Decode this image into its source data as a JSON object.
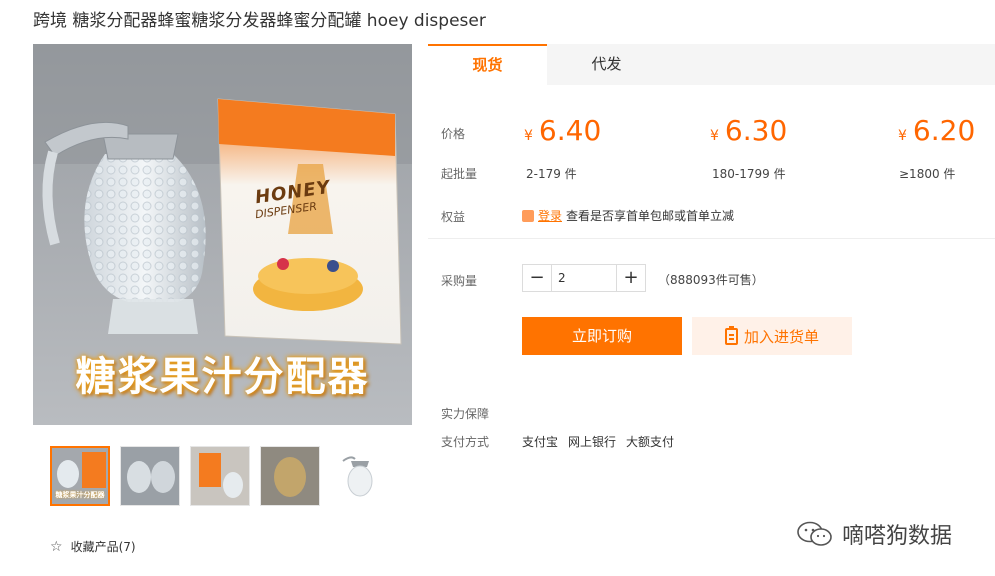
{
  "product": {
    "title": "跨境 糖浆分配器蜂蜜糖浆分发器蜂蜜分配罐 hoey dispeser",
    "image_overlay_text": "糖浆果汁分配器",
    "box_brand": "HONEY",
    "box_sub": "DISPENSER",
    "thumb_caption": "糖浆果汁分配器",
    "favorite": "收藏产品(7)"
  },
  "tabs": [
    {
      "label": "现货",
      "active": true
    },
    {
      "label": "代发",
      "active": false
    }
  ],
  "pricing": {
    "price_label": "价格",
    "currency": "¥",
    "tiers": [
      {
        "price": "6.40",
        "range": "2-179 件"
      },
      {
        "price": "6.30",
        "range": "180-1799 件"
      },
      {
        "price": "6.20",
        "range": "≥1800 件"
      }
    ],
    "min_qty_label": "起批量"
  },
  "benefit": {
    "label": "权益",
    "login": "登录",
    "text": "查看是否享首单包邮或首单立减"
  },
  "purchase": {
    "label": "采购量",
    "quantity": "2",
    "stock": "（888093件可售）",
    "buy_now": "立即订购",
    "add_to_list": "加入进货单"
  },
  "guarantee_label": "实力保障",
  "payment": {
    "label": "支付方式",
    "methods": [
      "支付宝",
      "网上银行",
      "大额支付"
    ]
  },
  "watermark": "嘀嗒狗数据",
  "colors": {
    "accent": "#ff7300",
    "price": "#ff6600",
    "cart_bg": "#fff1e8"
  }
}
